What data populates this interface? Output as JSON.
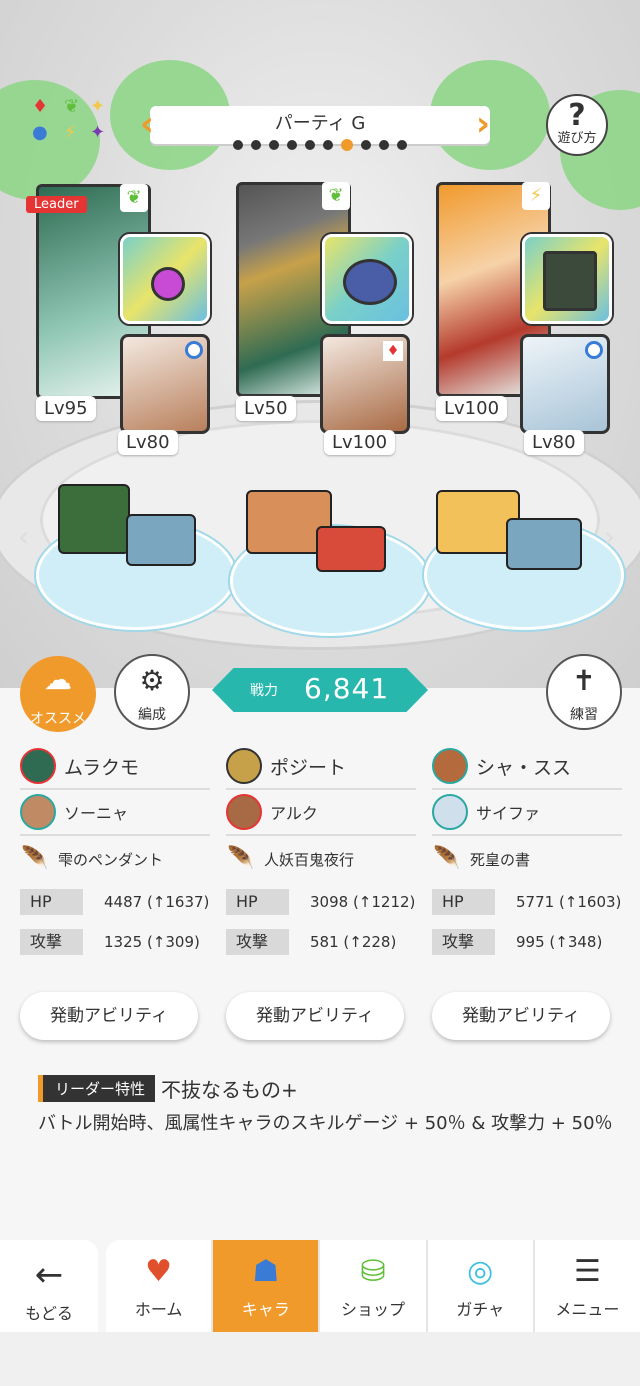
{
  "party": {
    "title": "パーティ G",
    "page_dots": 10,
    "active_dot": 7
  },
  "help": {
    "icon": "?",
    "label": "遊び方"
  },
  "leader_badge": "Leader",
  "cards": [
    {
      "name": "ムラクモ",
      "lv": "Lv95",
      "attr": "wind",
      "sub_lv": "Lv80"
    },
    {
      "name": "ポジート",
      "lv": "Lv50",
      "attr": "wind",
      "sub_lv": "Lv100"
    },
    {
      "name": "シャ・スス",
      "lv": "Lv100",
      "attr": "thunder",
      "sub_lv": "Lv80"
    }
  ],
  "buttons": {
    "recommend": "オススメ",
    "formation": "編成",
    "practice": "練習"
  },
  "power": {
    "label": "戦力",
    "value": "6,841"
  },
  "columns": [
    {
      "main": "ムラクモ",
      "sub": "ソーニャ",
      "item": "雫のペンダント",
      "hp": "4487 (↑1637)",
      "atk": "1325 (↑309)"
    },
    {
      "main": "ポジート",
      "sub": "アルク",
      "item": "人妖百鬼夜行",
      "hp": "3098 (↑1212)",
      "atk": "581 (↑228)"
    },
    {
      "main": "シャ・スス",
      "sub": "サイファ",
      "item": "死皇の書",
      "hp": "5771 (↑1603)",
      "atk": "995 (↑348)"
    }
  ],
  "stat_labels": {
    "hp": "HP",
    "atk": "攻撃"
  },
  "ability_label": "発動アビリティ",
  "leader_skill": {
    "tag": "リーダー特性",
    "name": "不抜なるもの+",
    "desc": "バトル開始時、風属性キャラのスキルゲージ + 50％ & 攻撃力 + 50％"
  },
  "nav": {
    "back": "もどる",
    "tabs": [
      "ホーム",
      "キャラ",
      "ショップ",
      "ガチャ",
      "メニュー"
    ],
    "active": "キャラ"
  },
  "colors": {
    "accent": "#f19a2c",
    "teal": "#27b7ad",
    "leader": "#e53434"
  }
}
